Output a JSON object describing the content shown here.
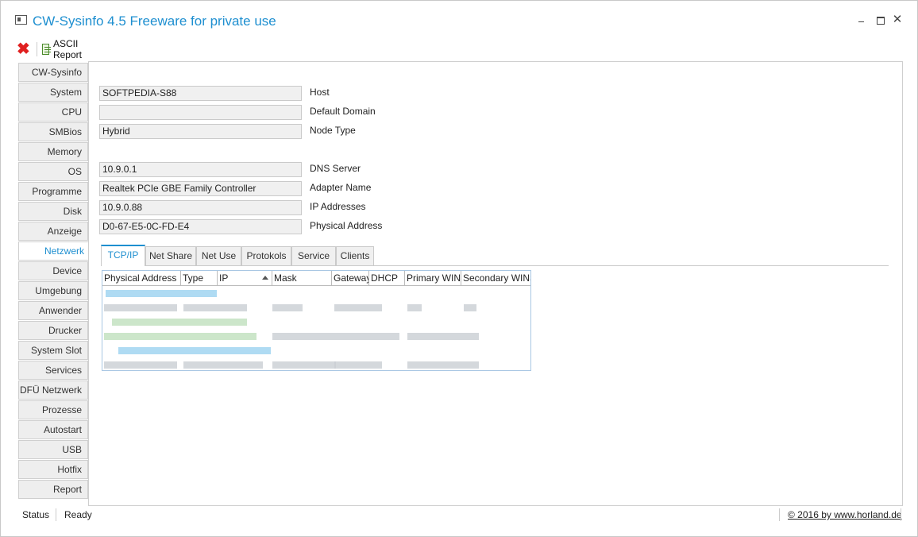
{
  "window": {
    "title": "CW-Sysinfo 4.5 Freeware for private use",
    "minimize_glyph": "",
    "maximize_glyph": "",
    "close_glyph": "✕"
  },
  "toolbar": {
    "close_icon": "red-x-icon",
    "report_icon": "report-icon",
    "report_label": "ASCII Report"
  },
  "sidebar": {
    "active": "Netzwerk",
    "items": [
      "CW-Sysinfo",
      "System",
      "CPU",
      "SMBios",
      "Memory",
      "OS",
      "Programme",
      "Disk",
      "Anzeige",
      "Netzwerk",
      "Device",
      "Umgebung",
      "Anwender",
      "Drucker",
      "System Slot",
      "Services",
      "DFÜ Netzwerk",
      "Prozesse",
      "Autostart",
      "USB",
      "Hotfix",
      "Report"
    ]
  },
  "network": {
    "host": {
      "value": "SOFTPEDIA-S88",
      "label": "Host"
    },
    "default_domain": {
      "value": "",
      "label": "Default Domain"
    },
    "node_type": {
      "value": "Hybrid",
      "label": "Node Type"
    },
    "dns_server": {
      "value": "10.9.0.1",
      "label": "DNS Server"
    },
    "adapter_name": {
      "value": "Realtek PCIe GBE Family Controller",
      "label": "Adapter Name"
    },
    "ip_addresses": {
      "value": "10.9.0.88",
      "label": "IP Addresses"
    },
    "physical_address": {
      "value": "D0-67-E5-0C-FD-E4",
      "label": "Physical Address"
    }
  },
  "tabs": {
    "active": "TCP/IP",
    "items": [
      "TCP/IP",
      "Net Share",
      "Net Use",
      "Protokols",
      "Service",
      "Clients"
    ]
  },
  "table": {
    "columns": [
      "Physical Address",
      "Type",
      "IP",
      "Mask",
      "Gateway",
      "DHCP",
      "Primary WINS",
      "Secondary WINS"
    ],
    "sorted_column": "IP",
    "sort_direction": "ascending",
    "rows_obscured": true
  },
  "statusbar": {
    "label": "Status",
    "text": "Ready",
    "copyright": "© 2016 by www.horland.de"
  },
  "colors": {
    "accent": "#1e8fd0",
    "close_red": "#e02020",
    "grid_border": "#a9c7e3"
  }
}
